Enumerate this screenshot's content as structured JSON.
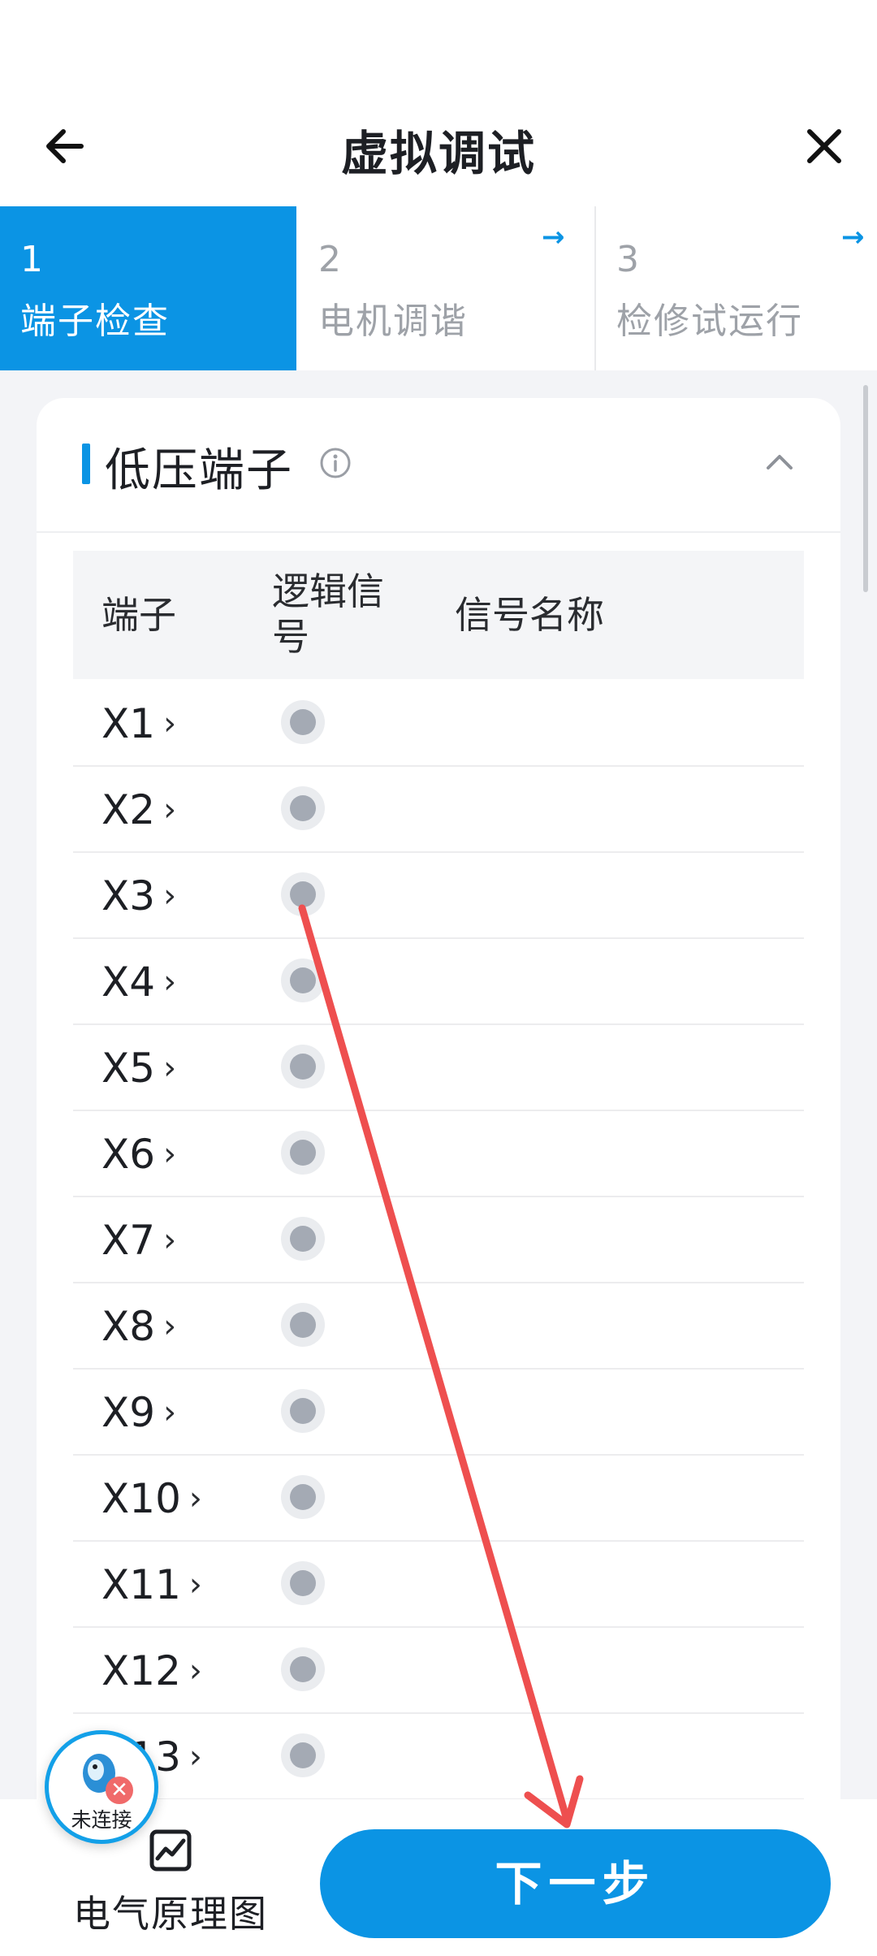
{
  "header": {
    "title": "虚拟调试"
  },
  "steps": [
    {
      "num": "1",
      "label": "端子检查"
    },
    {
      "num": "2",
      "label": "电机调谐"
    },
    {
      "num": "3",
      "label": "检修试运行"
    }
  ],
  "section": {
    "title": "低压端子"
  },
  "table": {
    "headers": {
      "terminal": "端子",
      "logic": "逻辑信号",
      "name": "信号名称"
    },
    "rows": [
      "X1",
      "X2",
      "X3",
      "X4",
      "X5",
      "X6",
      "X7",
      "X8",
      "X9",
      "X10",
      "X11",
      "X12",
      "X13"
    ]
  },
  "bottom": {
    "diagram_label": "电气原理图",
    "next_label": "下一步"
  },
  "badge": {
    "status": "未连接"
  },
  "colors": {
    "accent": "#0b94e4",
    "annotation_arrow": "#ee4f4f"
  }
}
